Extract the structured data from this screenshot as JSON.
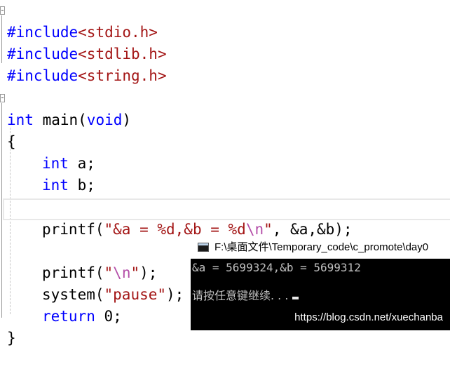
{
  "editor": {
    "line1": {
      "kw": "#include",
      "str": "<stdio.h>"
    },
    "line2": {
      "kw": "#include",
      "str": "<stdlib.h>"
    },
    "line3": {
      "kw": "#include",
      "str": "<string.h>"
    },
    "line5": {
      "type": "int",
      "name": " main(",
      "param": "void",
      "close": ")"
    },
    "line6": "{",
    "line7": {
      "type": "int",
      "rest": " a;"
    },
    "line8": {
      "type": "int",
      "rest": " b;"
    },
    "line10": {
      "call": "printf(",
      "str_a": "\"&a = %d,&b = %d",
      "esc": "\\n",
      "str_b": "\"",
      "rest": ", &a,&b);"
    },
    "line12": {
      "call": "printf(",
      "str_a": "\"",
      "esc": "\\n",
      "str_b": "\"",
      "rest": ");"
    },
    "line13": {
      "call": "system(",
      "str": "\"pause\"",
      "rest": ");"
    },
    "line14": {
      "kw": "return",
      "rest": " 0;"
    },
    "line15": "}"
  },
  "console": {
    "title": "F:\\桌面文件\\Temporary_code\\c_promote\\day0",
    "output_line1": "&a = 5699324,&b = 5699312",
    "output_line2": "请按任意键继续. . ."
  },
  "watermark": "https://blog.csdn.net/xuechanba",
  "colors": {
    "keyword": "#0000ff",
    "string": "#a31515",
    "escape": "#b44ea8",
    "console_bg": "#000000",
    "console_text": "#c0c0c0"
  }
}
